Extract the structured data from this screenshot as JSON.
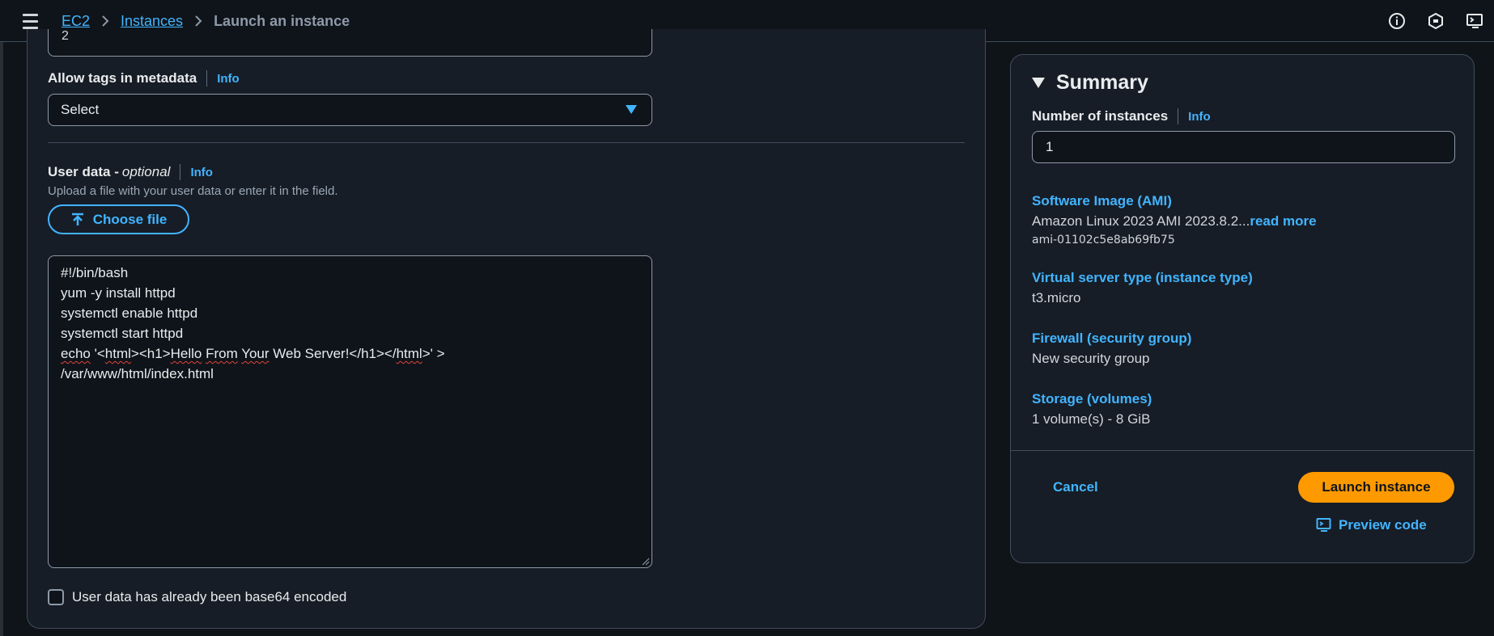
{
  "breadcrumb": {
    "items": [
      "EC2",
      "Instances"
    ],
    "current": "Launch an instance"
  },
  "top_icons": [
    "info-icon",
    "notifications-icon",
    "cloudshell-icon"
  ],
  "form": {
    "partial_value": "2",
    "allow_tags": {
      "label": "Allow tags in metadata",
      "info": "Info",
      "select_value": "Select"
    },
    "user_data": {
      "label": "User data - ",
      "optional": "optional",
      "info": "Info",
      "helper": "Upload a file with your user data or enter it in the field.",
      "choose_file": "Choose file",
      "lines": [
        "#!/bin/bash",
        "yum -y install httpd",
        "systemctl enable httpd",
        "systemctl start httpd",
        "echo '<html><h1>Hello From Your Web Server!</h1></html>' >",
        "/var/www/html/index.html"
      ],
      "base64_label": "User data has already been base64 encoded"
    }
  },
  "summary": {
    "title": "Summary",
    "num_instances_label": "Number of instances",
    "num_instances_info": "Info",
    "num_instances_value": "1",
    "ami_label": "Software Image (AMI)",
    "ami_value": "Amazon Linux 2023 AMI 2023.8.2...",
    "ami_read_more": "read more",
    "ami_id": "ami-01102c5e8ab69fb75",
    "instance_type_label": "Virtual server type (instance type)",
    "instance_type_value": "t3.micro",
    "firewall_label": "Firewall (security group)",
    "firewall_value": "New security group",
    "storage_label": "Storage (volumes)",
    "storage_value": "1 volume(s) - 8 GiB",
    "cancel": "Cancel",
    "launch": "Launch instance",
    "preview": "Preview code"
  },
  "colors": {
    "accent": "#42b4ff",
    "primary_button": "#ff9900",
    "background": "#0f1419",
    "panel": "#161d26"
  }
}
